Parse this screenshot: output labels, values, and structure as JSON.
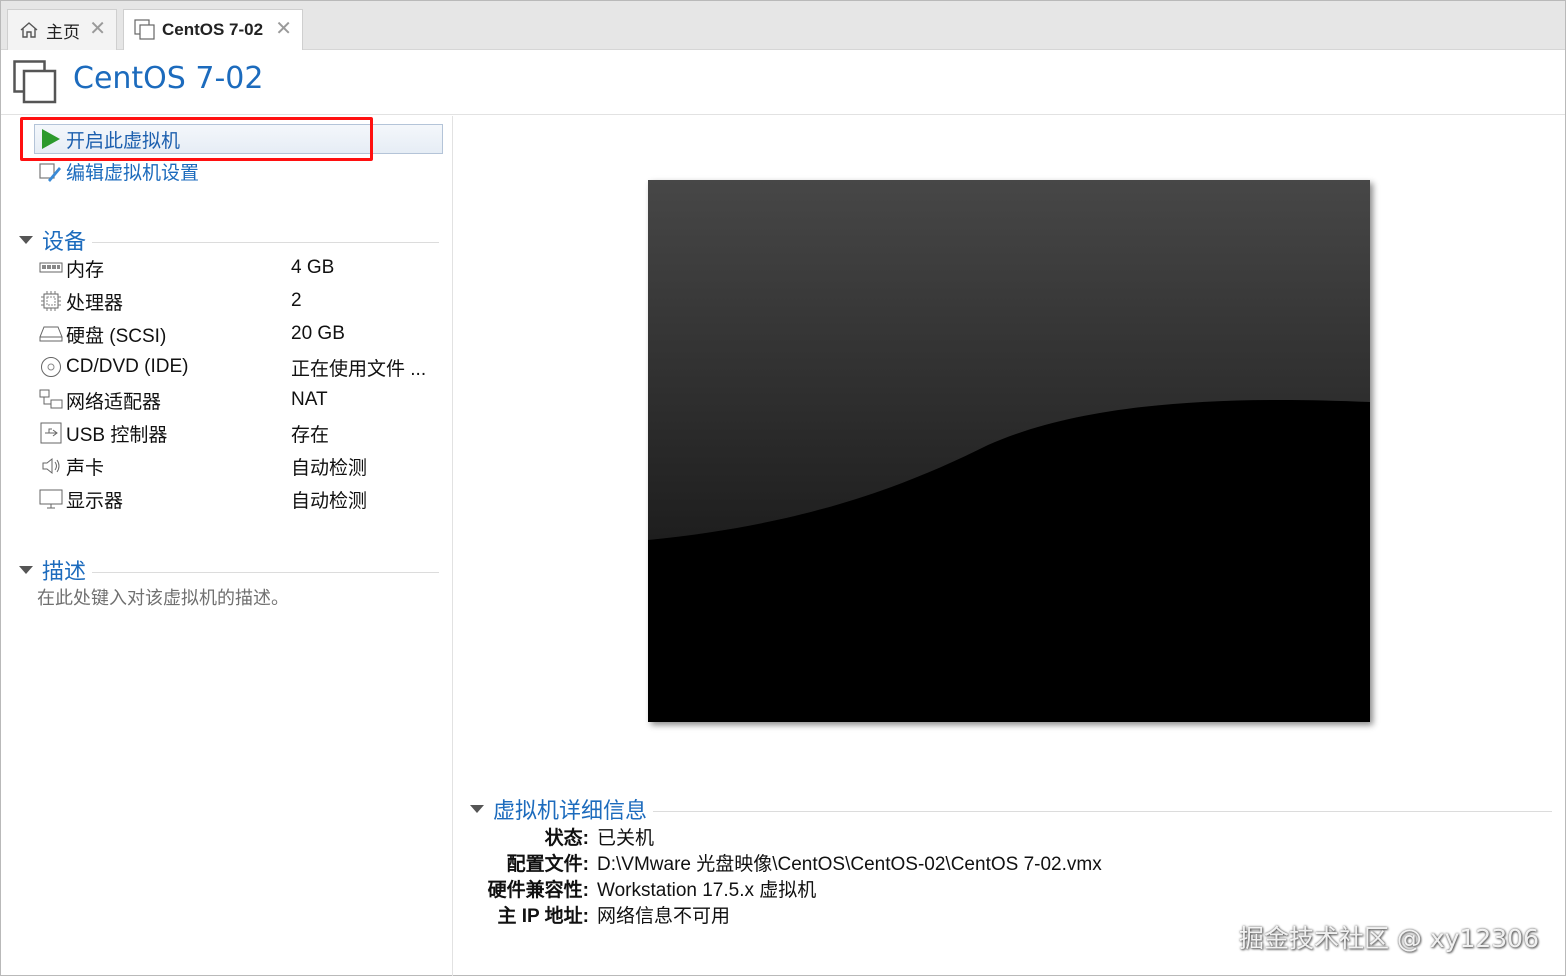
{
  "tabs": [
    {
      "label": "主页",
      "icon": "home-icon"
    },
    {
      "label": "CentOS 7-02",
      "icon": "vm-icon"
    }
  ],
  "header": {
    "title": "CentOS 7-02"
  },
  "actions": {
    "power_on_label": "开启此虚拟机",
    "edit_settings_label": "编辑虚拟机设置"
  },
  "devices": {
    "section_title": "设备",
    "items": [
      {
        "name": "内存",
        "value": "4 GB",
        "icon": "memory-icon"
      },
      {
        "name": "处理器",
        "value": "2",
        "icon": "cpu-icon"
      },
      {
        "name": "硬盘 (SCSI)",
        "value": "20 GB",
        "icon": "harddisk-icon"
      },
      {
        "name": "CD/DVD (IDE)",
        "value": "正在使用文件 ...",
        "icon": "cd-dvd-icon"
      },
      {
        "name": "网络适配器",
        "value": "NAT",
        "icon": "network-adapter-icon"
      },
      {
        "name": "USB 控制器",
        "value": "存在",
        "icon": "usb-icon"
      },
      {
        "name": "声卡",
        "value": "自动检测",
        "icon": "sound-icon"
      },
      {
        "name": "显示器",
        "value": "自动检测",
        "icon": "monitor-icon"
      }
    ]
  },
  "description": {
    "section_title": "描述",
    "placeholder": "在此处键入对该虚拟机的描述。"
  },
  "details": {
    "section_title": "虚拟机详细信息",
    "rows": [
      {
        "key": "状态:",
        "value": "已关机"
      },
      {
        "key": "配置文件:",
        "value": "D:\\VMware 光盘映像\\CentOS\\CentOS-02\\CentOS 7-02.vmx"
      },
      {
        "key": "硬件兼容性:",
        "value": "Workstation 17.5.x 虚拟机"
      },
      {
        "key": "主 IP 地址:",
        "value": "网络信息不可用"
      }
    ]
  },
  "watermark": "掘金技术社区 @ xy12306",
  "colors": {
    "accent": "#1c6bbd",
    "play": "#2c9a2c",
    "highlight": "#ff1010"
  }
}
